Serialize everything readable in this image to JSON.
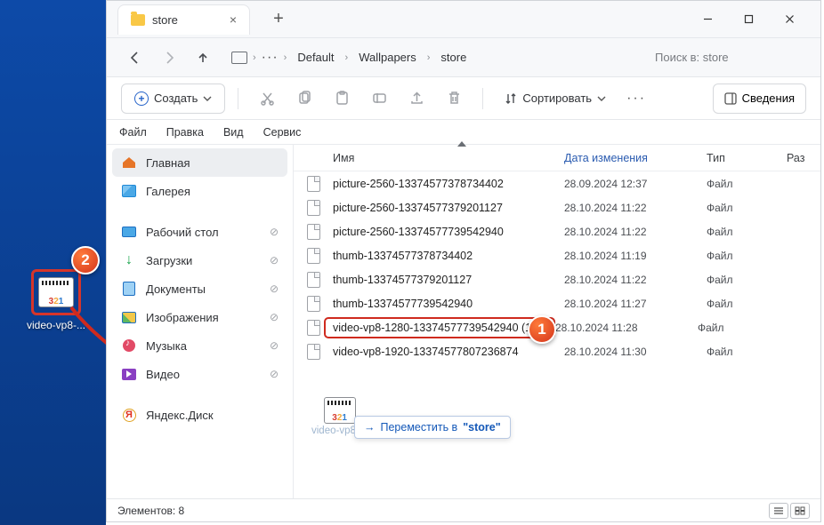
{
  "tab": {
    "title": "store",
    "close": "×",
    "new": "+"
  },
  "breadcrumbs": {
    "dots": "···",
    "items": [
      "Default",
      "Wallpapers",
      "store"
    ]
  },
  "search": {
    "placeholder": "Поиск в: store"
  },
  "toolbar": {
    "create": "Создать",
    "sort": "Сортировать",
    "details": "Сведения"
  },
  "menu": [
    "Файл",
    "Правка",
    "Вид",
    "Сервис"
  ],
  "sidebar": {
    "home": "Главная",
    "gallery": "Галерея",
    "pinned": [
      {
        "label": "Рабочий стол",
        "icon": "desk"
      },
      {
        "label": "Загрузки",
        "icon": "dl"
      },
      {
        "label": "Документы",
        "icon": "doc"
      },
      {
        "label": "Изображения",
        "icon": "pic"
      },
      {
        "label": "Музыка",
        "icon": "mus"
      },
      {
        "label": "Видео",
        "icon": "vid"
      }
    ],
    "yandex": "Яндекс.Диск"
  },
  "columns": {
    "name": "Имя",
    "date": "Дата изменения",
    "type": "Тип",
    "size": "Раз"
  },
  "files": [
    {
      "name": "picture-2560-13374577378734402",
      "date": "28.09.2024 12:37",
      "type": "Файл"
    },
    {
      "name": "picture-2560-13374577379201127",
      "date": "28.10.2024 11:22",
      "type": "Файл"
    },
    {
      "name": "picture-2560-13374577739542940",
      "date": "28.10.2024 11:22",
      "type": "Файл"
    },
    {
      "name": "thumb-13374577378734402",
      "date": "28.10.2024 11:19",
      "type": "Файл"
    },
    {
      "name": "thumb-13374577379201127",
      "date": "28.10.2024 11:22",
      "type": "Файл"
    },
    {
      "name": "thumb-13374577739542940",
      "date": "28.10.2024 11:27",
      "type": "Файл"
    },
    {
      "name": "video-vp8-1280-13374577739542940 (1)",
      "date": "28.10.2024 11:28",
      "type": "Файл",
      "hl": true
    },
    {
      "name": "video-vp8-1920-13374577807236874",
      "date": "28.10.2024 11:30",
      "type": "Файл"
    }
  ],
  "status": {
    "count": "Элементов: 8"
  },
  "drag": {
    "ghost_label": "video-vp8-...",
    "action_prefix": "Переместить в",
    "action_target": "\"store\""
  },
  "desktop": {
    "label": "video-vp8-..."
  },
  "callouts": {
    "one": "1",
    "two": "2"
  }
}
